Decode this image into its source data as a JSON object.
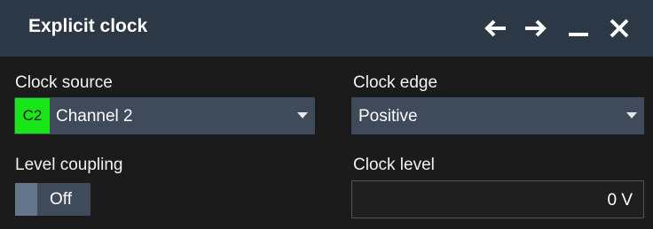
{
  "dialog": {
    "title": "Explicit clock",
    "icons": [
      "arrow-left-icon",
      "arrow-right-icon",
      "minimize-icon",
      "close-icon"
    ]
  },
  "clock_source": {
    "label": "Clock source",
    "badge": "C2",
    "value": "Channel 2",
    "badge_color": "#19e619"
  },
  "clock_edge": {
    "label": "Clock edge",
    "value": "Positive"
  },
  "level_coupling": {
    "label": "Level coupling",
    "value": "Off"
  },
  "clock_level": {
    "label": "Clock level",
    "value": "0 V"
  },
  "colors": {
    "titlebar": "#2d3846",
    "background": "#1b1b1b",
    "control": "#3f4b5a"
  }
}
